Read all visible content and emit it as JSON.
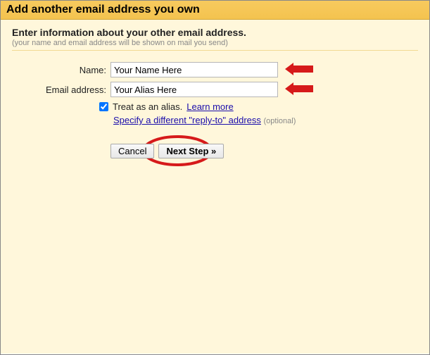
{
  "header": {
    "title": "Add another email address you own"
  },
  "intro": {
    "subtitle": "Enter information about your other email address.",
    "hint": "(your name and email address will be shown on mail you send)"
  },
  "form": {
    "name_label": "Name:",
    "name_value": "Your Name Here",
    "email_label": "Email address:",
    "email_value": "Your Alias Here",
    "alias_label": "Treat as an alias.",
    "learn_more": "Learn more",
    "reply_to_link": "Specify a different \"reply-to\" address",
    "optional": "(optional)"
  },
  "buttons": {
    "cancel": "Cancel",
    "next": "Next Step »"
  }
}
